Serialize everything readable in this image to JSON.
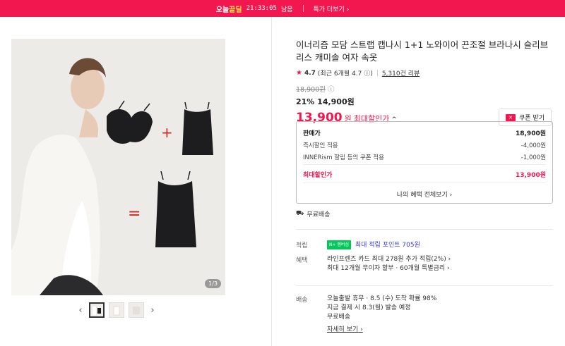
{
  "topbar": {
    "tag_prefix": "오늘",
    "tag_highlight": "끝딜",
    "timer": "21:33:05",
    "remain": "남음",
    "more": "특가 더보기",
    "colors": {
      "bg": "#f2184f",
      "highlight": "#ffe14d"
    }
  },
  "gallery": {
    "pager": "1/3",
    "thumbs": [
      "thumb-1",
      "thumb-2",
      "thumb-3"
    ],
    "prev_icon": "chevron-left-icon",
    "next_icon": "chevron-right-icon"
  },
  "product": {
    "title": "이너리즘 모담 스트랩 캡나시 1+1 노와이어 끈조절 브라나시 슬리브리스 캐미솔 여자 속옷",
    "rating": "4.7",
    "rating_note": "(최근 6개월 4.7",
    "rating_info": "ⓘ)",
    "reviews": "5,310건 리뷰",
    "orig_price": "18,900원",
    "discount_line": "21% 14,900원",
    "max_price": "13,900",
    "max_price_unit": "원",
    "max_label": "최대할인가",
    "coupon_btn": "쿠폰 받기"
  },
  "price_box": {
    "rows": [
      {
        "label": "판매가",
        "value": "18,900원"
      },
      {
        "label": "즉시할인 적용",
        "value": "-4,000원"
      },
      {
        "label": "INNERism 할림 등의 쿠폰 적용",
        "value": "-1,000원"
      }
    ],
    "final": {
      "label": "최대할인가",
      "value": "13,900원"
    },
    "benefit_link": "나의 혜택 전체보기"
  },
  "shipping_free": "무료배송",
  "info": {
    "accum_label": "적립",
    "npay": "N+ 멤버십",
    "accum_value": "최대 적립 포인트 705원",
    "benefit_label": "혜택",
    "benefit_lines": [
      "라인프렌즈 카드 최대 278원 추가 적립(2%)",
      "최대 12개월 무이자 할부 · 60개월 특별금리"
    ],
    "ship_label": "배송",
    "ship_lines": [
      "오늘출발 휴무 · 8.5 (수) 도착 확률 98%",
      "지금 결제 시 8.3(월) 발송 예정",
      "무료배송"
    ],
    "ship_more": "자세히 보기"
  }
}
